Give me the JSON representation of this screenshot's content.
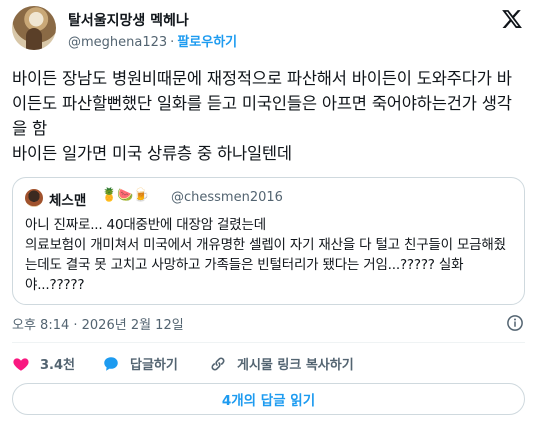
{
  "author": {
    "display_name": "탈서울지망생 멕헤나",
    "handle": "@meghena123",
    "separator": "·",
    "follow_label": "팔로우하기"
  },
  "tweet": {
    "text": "바이든 장남도 병원비때문에 재정적으로 파산해서 바이든이 도와주다가 바이든도 파산할뻔했단 일화를 듣고 미국인들은 아프면 죽어야하는건가 생각을 함\n바이든 일가면 미국 상류층 중 하나일텐데"
  },
  "quoted_tweet": {
    "display_name": "체스맨",
    "emojis": "🍍🍉🍺",
    "handle": "@chessmen2016",
    "text": "아니 진짜로... 40대중반에 대장암 걸렸는데\n의료보험이 개미쳐서 미국에서 개유명한 셀렙이 자기 재산을 다 털고 친구들이 모금해줬는데도 결국 못 고치고 사망하고 가족들은 빈털터리가 됐다는 거임...????? 실화야...?????"
  },
  "meta": {
    "timestamp": "오후 8:14 · 2026년 2월 12일"
  },
  "actions": {
    "likes_count": "3.4천",
    "reply_label": "답글하기",
    "copy_link_label": "게시물 링크 복사하기"
  },
  "read_replies_label": "4개의 답글 읽기",
  "colors": {
    "accent": "#1d9bf0",
    "like": "#f91880",
    "text": "#0f1419",
    "muted": "#536471",
    "border": "#cfd9de"
  },
  "icons": [
    "x-logo-icon",
    "info-icon",
    "heart-icon",
    "reply-bubble-icon",
    "link-icon"
  ]
}
